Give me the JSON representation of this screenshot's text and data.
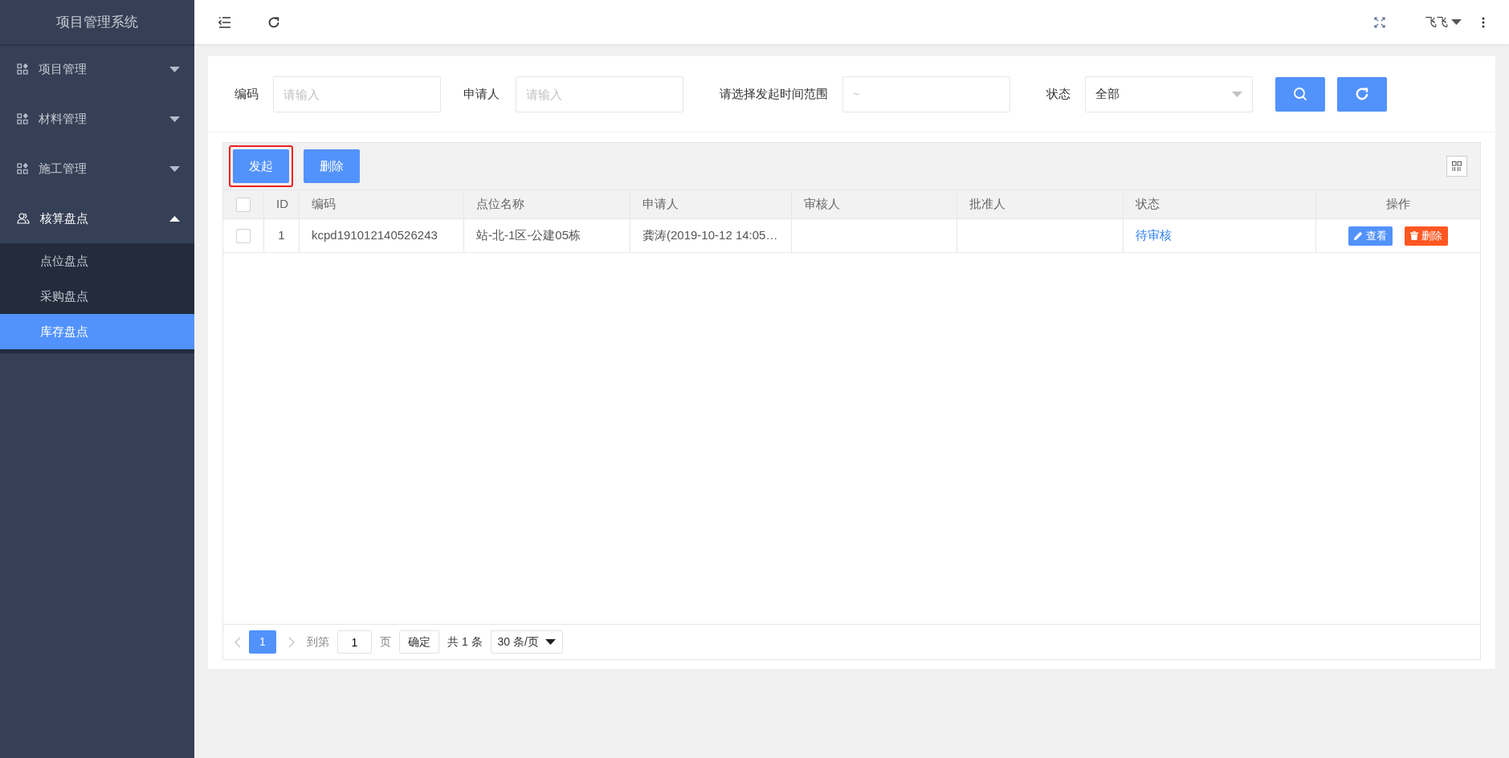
{
  "sidebar": {
    "title": "项目管理系统",
    "items": [
      {
        "label": "项目管理",
        "kind": "module",
        "expanded": false
      },
      {
        "label": "材料管理",
        "kind": "module",
        "expanded": false
      },
      {
        "label": "施工管理",
        "kind": "module",
        "expanded": false
      },
      {
        "label": "核算盘点",
        "kind": "accounting",
        "expanded": true,
        "children": [
          {
            "label": "点位盘点",
            "selected": false
          },
          {
            "label": "采购盘点",
            "selected": false
          },
          {
            "label": "库存盘点",
            "selected": true
          }
        ]
      }
    ]
  },
  "topbar": {
    "user": "飞飞"
  },
  "filters": [
    {
      "kind": "input",
      "label": "编码",
      "placeholder": "请输入"
    },
    {
      "kind": "input",
      "label": "申请人",
      "placeholder": "请输入"
    },
    {
      "kind": "range",
      "label": "请选择发起时间范围",
      "placeholder": "~"
    },
    {
      "kind": "select",
      "label": "状态",
      "value": "全部"
    }
  ],
  "toolbar": [
    {
      "label": "发起",
      "highlighted": true
    },
    {
      "label": "删除",
      "highlighted": false
    }
  ],
  "table": {
    "all_checked": false,
    "columns": [
      "ID",
      "编码",
      "点位名称",
      "申请人",
      "审核人",
      "批准人",
      "状态",
      "操作"
    ],
    "rows": [
      {
        "checked": false,
        "cells": [
          "1",
          "kcpd191012140526243",
          "站-北-1区-公建05栋",
          "龚涛(2019-10-12 14:05…",
          "",
          "",
          "待审核"
        ],
        "actions": [
          {
            "kind": "view",
            "label": "查看"
          },
          {
            "kind": "delete",
            "label": "删除"
          }
        ]
      }
    ]
  },
  "pagination": {
    "pages": [
      {
        "label": "1",
        "selected": true
      }
    ],
    "goto_label": "到第",
    "goto_value": "1",
    "page_unit": "页",
    "confirm": "确定",
    "total": "共 1 条",
    "page_size": "30 条/页"
  }
}
